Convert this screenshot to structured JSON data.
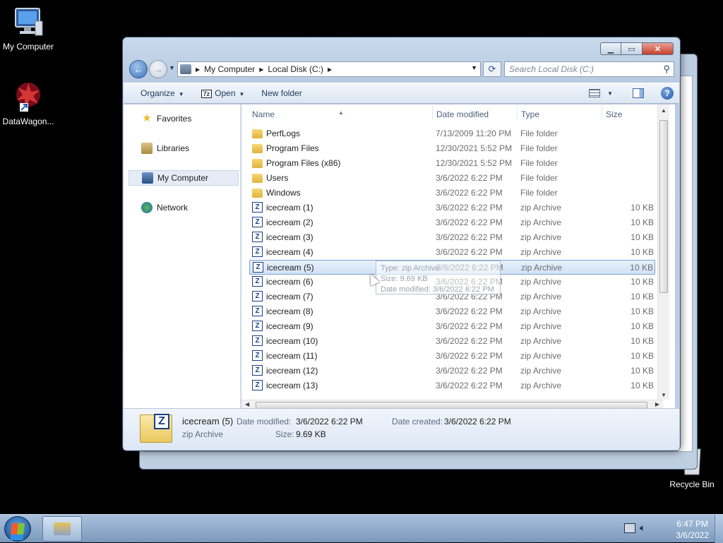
{
  "desktop": {
    "icons": [
      {
        "label": "My Computer"
      },
      {
        "label": "DataWagon..."
      },
      {
        "label": "Recycle Bin"
      }
    ]
  },
  "window": {
    "address": {
      "crumbs": [
        "My Computer",
        "Local Disk (C:)"
      ]
    },
    "search": {
      "placeholder": "Search Local Disk (C:)"
    },
    "toolbar": {
      "organize": "Organize",
      "open": "Open",
      "open_badge": "7z",
      "new_folder": "New folder"
    },
    "nav_pane": {
      "items": [
        {
          "label": "Favorites",
          "icon": "star-icon"
        },
        {
          "label": "Libraries",
          "icon": "libraries-icon"
        },
        {
          "label": "My Computer",
          "icon": "computer-icon",
          "selected": true
        },
        {
          "label": "Network",
          "icon": "network-icon"
        }
      ]
    },
    "columns": {
      "name": "Name",
      "date": "Date modified",
      "type": "Type",
      "size": "Size"
    },
    "files": [
      {
        "name": "PerfLogs",
        "date": "7/13/2009 11:20 PM",
        "type": "File folder",
        "size": "",
        "kind": "folder"
      },
      {
        "name": "Program Files",
        "date": "12/30/2021 5:52 PM",
        "type": "File folder",
        "size": "",
        "kind": "folder"
      },
      {
        "name": "Program Files (x86)",
        "date": "12/30/2021 5:52 PM",
        "type": "File folder",
        "size": "",
        "kind": "folder"
      },
      {
        "name": "Users",
        "date": "3/6/2022 6:22 PM",
        "type": "File folder",
        "size": "",
        "kind": "folder"
      },
      {
        "name": "Windows",
        "date": "3/6/2022 6:22 PM",
        "type": "File folder",
        "size": "",
        "kind": "folder"
      },
      {
        "name": "icecream (1)",
        "date": "3/6/2022 6:22 PM",
        "type": "zip Archive",
        "size": "10 KB",
        "kind": "zip"
      },
      {
        "name": "icecream (2)",
        "date": "3/6/2022 6:22 PM",
        "type": "zip Archive",
        "size": "10 KB",
        "kind": "zip"
      },
      {
        "name": "icecream (3)",
        "date": "3/6/2022 6:22 PM",
        "type": "zip Archive",
        "size": "10 KB",
        "kind": "zip"
      },
      {
        "name": "icecream (4)",
        "date": "3/6/2022 6:22 PM",
        "type": "zip Archive",
        "size": "10 KB",
        "kind": "zip"
      },
      {
        "name": "icecream (5)",
        "date": "3/6/2022 6:22 PM",
        "type": "zip Archive",
        "size": "10 KB",
        "kind": "zip",
        "selected": true
      },
      {
        "name": "icecream (6)",
        "date": "3/6/2022 6:22 PM",
        "type": "zip Archive",
        "size": "10 KB",
        "kind": "zip"
      },
      {
        "name": "icecream (7)",
        "date": "3/6/2022 6:22 PM",
        "type": "zip Archive",
        "size": "10 KB",
        "kind": "zip"
      },
      {
        "name": "icecream (8)",
        "date": "3/6/2022 6:22 PM",
        "type": "zip Archive",
        "size": "10 KB",
        "kind": "zip"
      },
      {
        "name": "icecream (9)",
        "date": "3/6/2022 6:22 PM",
        "type": "zip Archive",
        "size": "10 KB",
        "kind": "zip"
      },
      {
        "name": "icecream (10)",
        "date": "3/6/2022 6:22 PM",
        "type": "zip Archive",
        "size": "10 KB",
        "kind": "zip"
      },
      {
        "name": "icecream (11)",
        "date": "3/6/2022 6:22 PM",
        "type": "zip Archive",
        "size": "10 KB",
        "kind": "zip"
      },
      {
        "name": "icecream (12)",
        "date": "3/6/2022 6:22 PM",
        "type": "zip Archive",
        "size": "10 KB",
        "kind": "zip"
      },
      {
        "name": "icecream (13)",
        "date": "3/6/2022 6:22 PM",
        "type": "zip Archive",
        "size": "10 KB",
        "kind": "zip"
      }
    ],
    "tooltip": {
      "type_line": "Type: zip Archive",
      "size_line": "Size: 9.69 KB",
      "date_line": "Date modified: 3/6/2022 6:22 PM"
    },
    "details": {
      "title": "icecream (5)",
      "subtitle": "zip Archive",
      "date_modified_label": "Date modified:",
      "date_modified_value": "3/6/2022 6:22 PM",
      "date_created_label": "Date created:",
      "date_created_value": "3/6/2022 6:22 PM",
      "size_label": "Size:",
      "size_value": "9.69 KB"
    }
  },
  "taskbar": {
    "clock_time": "6:47 PM",
    "clock_date": "3/6/2022"
  },
  "colors": {
    "selection": "#d0e2f7",
    "selection_border": "#7da2ce",
    "accent": "#1e395b"
  }
}
